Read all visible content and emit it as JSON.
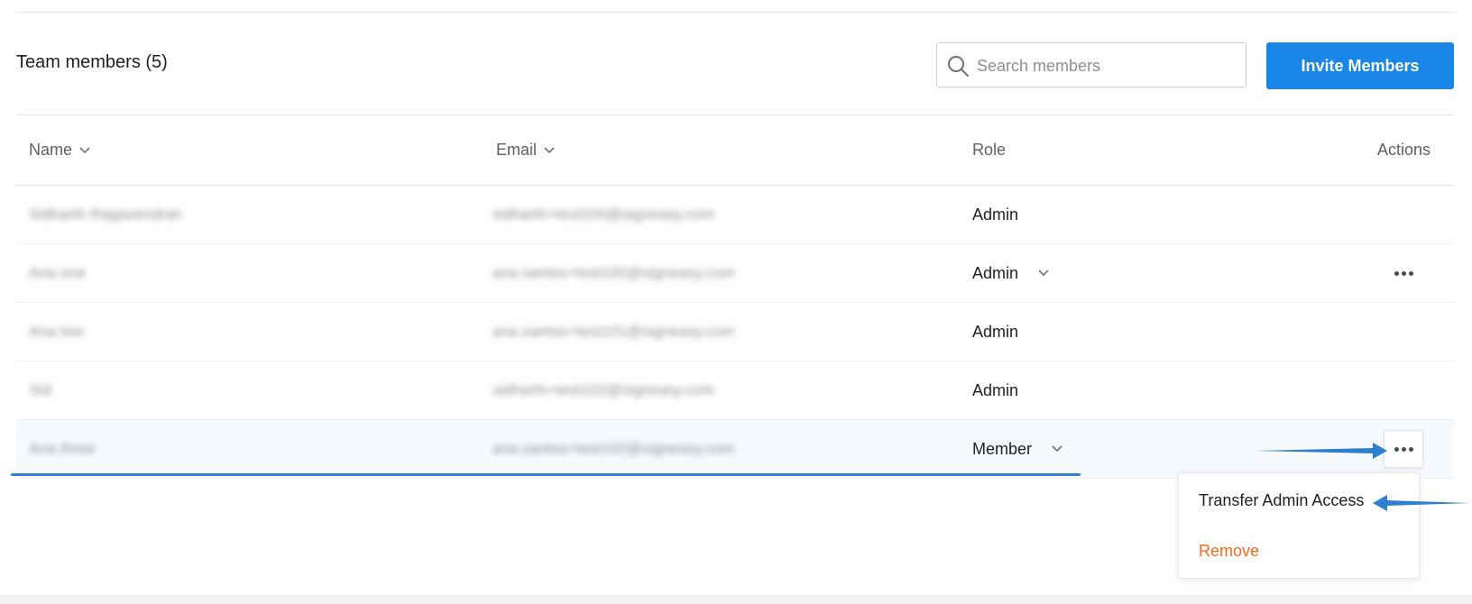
{
  "header": {
    "title": "Team members (5)",
    "search_placeholder": "Search members",
    "invite_label": "Invite Members"
  },
  "table": {
    "columns": {
      "name": "Name",
      "email": "Email",
      "role": "Role",
      "actions": "Actions"
    },
    "rows": [
      {
        "name": "Sidharth Ragavendran",
        "email": "sidharth+test100@signeasy.com",
        "role": "Admin"
      },
      {
        "name": "Ana one",
        "email": "ana.santos+test100@signeasy.com",
        "role": "Admin"
      },
      {
        "name": "Ana two",
        "email": "ana.santos+test101@signeasy.com",
        "role": "Admin"
      },
      {
        "name": "Sid",
        "email": "sidharth+test102@signeasy.com",
        "role": "Admin"
      },
      {
        "name": "Ana three",
        "email": "ana.santos+test102@signeasy.com",
        "role": "Member"
      }
    ]
  },
  "menu": {
    "transfer": "Transfer Admin Access",
    "remove": "Remove"
  },
  "colors": {
    "accent": "#1a86e8",
    "annotation": "#2f7fd0",
    "danger": "#f26a1b"
  },
  "icons": {
    "search": "search-icon",
    "sort": "chevron-down-icon",
    "actions": "more-horizontal-icon"
  }
}
